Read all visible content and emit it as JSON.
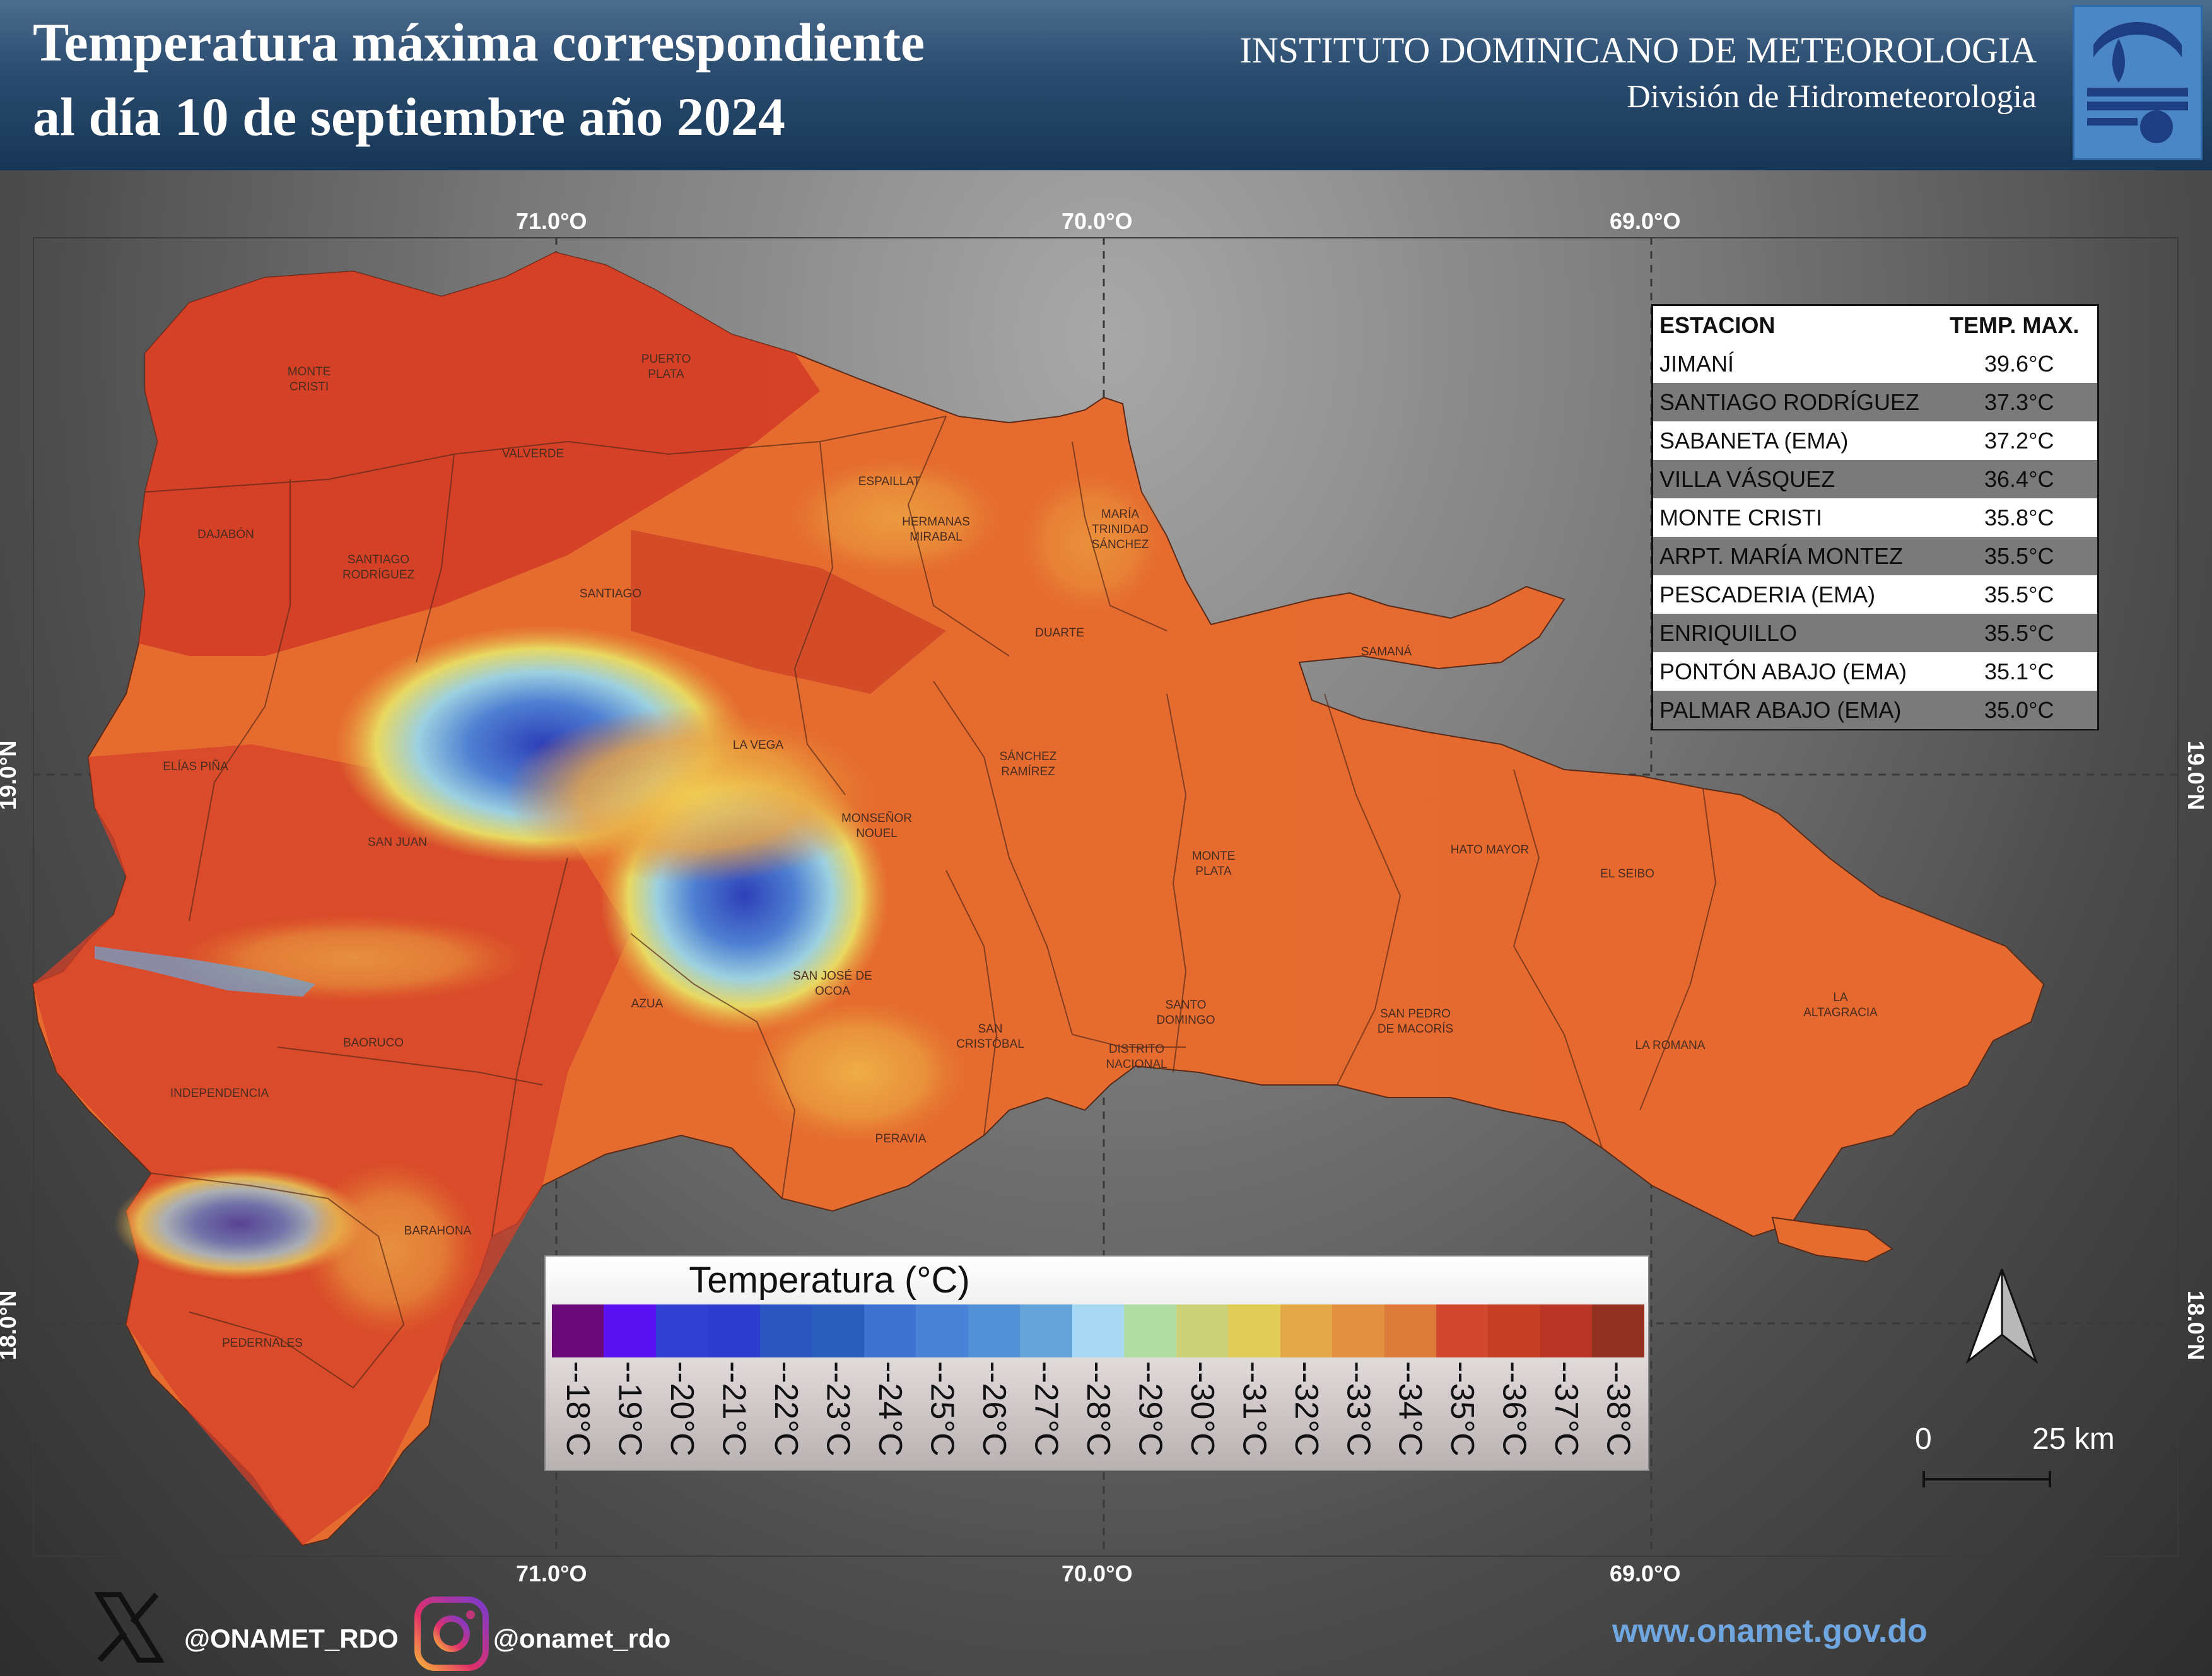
{
  "header": {
    "title_line1": "Temperatura máxima correspondiente",
    "title_line2": "al día 10 de septiembre año 2024",
    "institute": "INSTITUTO DOMINICANO DE METEOROLOGIA",
    "division": "División de Hidrometeorologia"
  },
  "coordinates": {
    "lon_labels": [
      "71.0°O",
      "70.0°O",
      "69.0°O"
    ],
    "lat_labels": [
      "19.0°N",
      "18.0°N"
    ]
  },
  "places": [
    "MONTE\nCRISTI",
    "PUERTO\nPLATA",
    "VALVERDE",
    "ESPAILLAT",
    "HERMANAS\nMIRABAL",
    "MARÍA\nTRINIDAD\nSÁNCHEZ",
    "DAJABÓN",
    "SANTIAGO\nRODRÍGUEZ",
    "SANTIAGO",
    "DUARTE",
    "SAMANÁ",
    "LA VEGA",
    "SÁNCHEZ\nRAMÍREZ",
    "ELÍAS PIÑA",
    "MONSEÑOR\nNOUEL",
    "SAN JUAN",
    "MONTE\nPLATA",
    "HATO MAYOR",
    "EL SEIBO",
    "SAN JOSÉ DE\nOCOA",
    "AZUA",
    "SAN\nCRISTÓBAL",
    "SANTO\nDOMINGO",
    "DISTRITO\nNACIONAL",
    "SAN PEDRO\nDE MACORÍS",
    "LA ROMANA",
    "LA\nALTAGRACIA",
    "BAORUCO",
    "INDEPENDENCIA",
    "PERAVIA",
    "BARAHONA",
    "PEDERNALES"
  ],
  "table": {
    "headers": [
      "ESTACION",
      "TEMP. MAX."
    ],
    "rows": [
      {
        "station": "JIMANÍ",
        "temp": "39.6°C"
      },
      {
        "station": "SANTIAGO RODRÍGUEZ",
        "temp": "37.3°C"
      },
      {
        "station": "SABANETA (EMA)",
        "temp": "37.2°C"
      },
      {
        "station": "VILLA VÁSQUEZ",
        "temp": "36.4°C"
      },
      {
        "station": "MONTE CRISTI",
        "temp": "35.8°C"
      },
      {
        "station": "ARPT. MARÍA MONTEZ",
        "temp": "35.5°C"
      },
      {
        "station": "PESCADERIA (EMA)",
        "temp": "35.5°C"
      },
      {
        "station": "ENRIQUILLO",
        "temp": "35.5°C"
      },
      {
        "station": "PONTÓN ABAJO (EMA)",
        "temp": "35.1°C"
      },
      {
        "station": "PALMAR ABAJO (EMA)",
        "temp": "35.0°C"
      }
    ]
  },
  "legend": {
    "title": "Temperatura (°C)",
    "labels": [
      "--18°C",
      "--19°C",
      "--20°C",
      "--21°C",
      "--22°C",
      "--23°C",
      "--24°C",
      "--25°C",
      "--26°C",
      "--27°C",
      "--28°C",
      "--29°C",
      "--30°C",
      "--31°C",
      "--32°C",
      "--33°C",
      "--34°C",
      "--35°C",
      "--36°C",
      "--37°C",
      "--38°C"
    ],
    "colors": [
      "#6a0a78",
      "#5a12f2",
      "#2f3fd1",
      "#2c3ccc",
      "#2b56c0",
      "#2a5cba",
      "#3e73cf",
      "#4a82d8",
      "#5290d5",
      "#65a4d8",
      "#a8d8f2",
      "#b2dea6",
      "#ccd27a",
      "#e2cc58",
      "#e2a848",
      "#e09040",
      "#dc7a3a",
      "#d2482e",
      "#c43e26",
      "#b83424",
      "#923022"
    ]
  },
  "scale": {
    "zero": "0",
    "end": "25 km"
  },
  "footer": {
    "x_handle": "@ONAMET_RDO",
    "ig_handle": "@onamet_rdo",
    "website": "www.onamet.gov.do"
  },
  "icons": [
    "x-logo-icon",
    "instagram-icon",
    "north-arrow-icon",
    "onamet-logo-icon"
  ]
}
